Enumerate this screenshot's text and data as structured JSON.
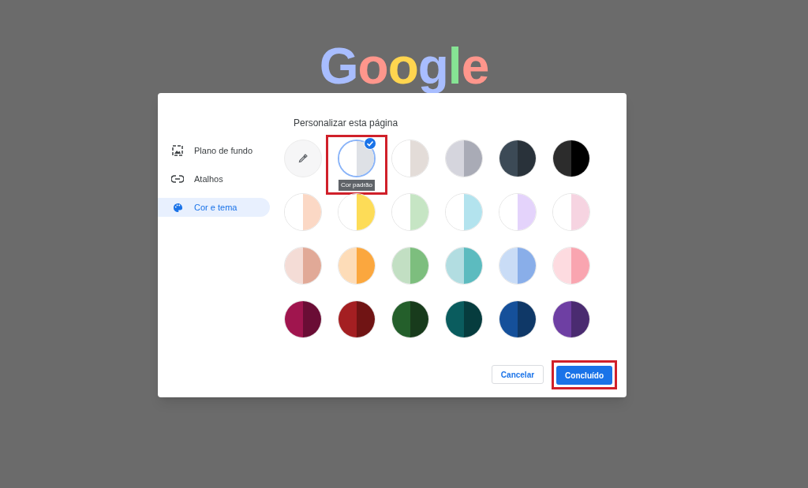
{
  "logo": {
    "text": "Google"
  },
  "dialog": {
    "title": "Personalizar esta página",
    "sidebar": [
      {
        "label": "Plano de fundo",
        "selected": false
      },
      {
        "label": "Atalhos",
        "selected": false
      },
      {
        "label": "Cor e tema",
        "selected": true
      }
    ],
    "swatches": [
      {
        "kind": "picker",
        "selected": false
      },
      {
        "kind": "color",
        "halves": [
          {
            "color": "#ffffff"
          },
          {
            "color": "#dee1e6"
          }
        ],
        "selected": true,
        "tooltip": "Cor padrão"
      },
      {
        "kind": "color",
        "halves": [
          {
            "color": "#ffffff"
          },
          {
            "color": "#e3dcd8"
          }
        ],
        "selected": false
      },
      {
        "kind": "color",
        "halves": [
          {
            "color": "#d5d5dd"
          },
          {
            "color": "#a9abb6"
          }
        ],
        "selected": false
      },
      {
        "kind": "color",
        "halves": [
          {
            "color": "#3c4a56"
          },
          {
            "color": "#29323a"
          }
        ],
        "selected": false
      },
      {
        "kind": "color",
        "halves": [
          {
            "color": "#2c2c2c"
          },
          {
            "color": "#000000"
          }
        ],
        "selected": false
      },
      {
        "kind": "color",
        "halves": [
          {
            "color": "#ffffff"
          },
          {
            "color": "#fbd8c5"
          }
        ],
        "selected": false
      },
      {
        "kind": "color",
        "halves": [
          {
            "color": "#ffffff"
          },
          {
            "color": "#fddc57"
          }
        ],
        "selected": false
      },
      {
        "kind": "color",
        "halves": [
          {
            "color": "#ffffff"
          },
          {
            "color": "#c6e5c4"
          }
        ],
        "selected": false
      },
      {
        "kind": "color",
        "halves": [
          {
            "color": "#ffffff"
          },
          {
            "color": "#b3e3ee"
          }
        ],
        "selected": false
      },
      {
        "kind": "color",
        "halves": [
          {
            "color": "#ffffff"
          },
          {
            "color": "#e4d3fb"
          }
        ],
        "selected": false
      },
      {
        "kind": "color",
        "halves": [
          {
            "color": "#ffffff"
          },
          {
            "color": "#f6d4e1"
          }
        ],
        "selected": false
      },
      {
        "kind": "color",
        "halves": [
          {
            "color": "#f4dcd6"
          },
          {
            "color": "#e1a997"
          }
        ],
        "selected": false
      },
      {
        "kind": "color",
        "halves": [
          {
            "color": "#fddcb8"
          },
          {
            "color": "#fba73e"
          }
        ],
        "selected": false
      },
      {
        "kind": "color",
        "halves": [
          {
            "color": "#c2dfc3"
          },
          {
            "color": "#7dbe7e"
          }
        ],
        "selected": false
      },
      {
        "kind": "color",
        "halves": [
          {
            "color": "#b2dde1"
          },
          {
            "color": "#5cbbbf"
          }
        ],
        "selected": false
      },
      {
        "kind": "color",
        "halves": [
          {
            "color": "#c9dcf6"
          },
          {
            "color": "#89aee9"
          }
        ],
        "selected": false
      },
      {
        "kind": "color",
        "halves": [
          {
            "color": "#fddbe0"
          },
          {
            "color": "#f9a5b0"
          }
        ],
        "selected": false
      },
      {
        "kind": "color",
        "halves": [
          {
            "color": "#a0154e"
          },
          {
            "color": "#6a0d35"
          }
        ],
        "selected": false
      },
      {
        "kind": "color",
        "halves": [
          {
            "color": "#a41f22"
          },
          {
            "color": "#701414"
          }
        ],
        "selected": false
      },
      {
        "kind": "color",
        "halves": [
          {
            "color": "#245f2b"
          },
          {
            "color": "#183b1c"
          }
        ],
        "selected": false
      },
      {
        "kind": "color",
        "halves": [
          {
            "color": "#0a5c5e"
          },
          {
            "color": "#063c3e"
          }
        ],
        "selected": false
      },
      {
        "kind": "color",
        "halves": [
          {
            "color": "#15509a"
          },
          {
            "color": "#0f3867"
          }
        ],
        "selected": false
      },
      {
        "kind": "color",
        "halves": [
          {
            "color": "#6e3fa3"
          },
          {
            "color": "#4a2b70"
          }
        ],
        "selected": false
      }
    ],
    "buttons": [
      {
        "label": "Cancelar",
        "kind": "secondary",
        "highlighted": false
      },
      {
        "label": "Concluído",
        "kind": "primary",
        "highlighted": true
      }
    ]
  }
}
